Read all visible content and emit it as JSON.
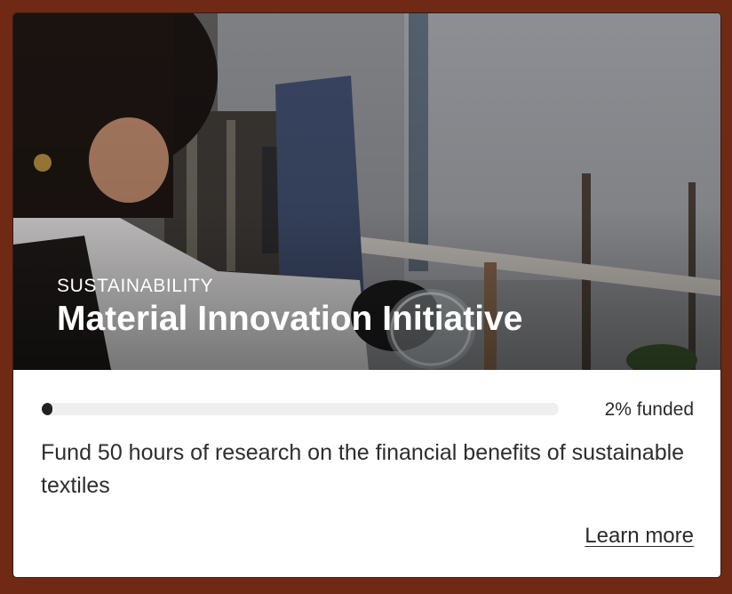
{
  "hero": {
    "category": "SUSTAINABILITY",
    "title": "Material Innovation Initiative"
  },
  "funding": {
    "percent": 2,
    "label": "2% funded"
  },
  "description": "Fund 50 hours of research on the financial benefits of sustainable textiles",
  "link": {
    "label": "Learn more"
  },
  "colors": {
    "frame": "#6f2914",
    "card": "#ffffff",
    "progress_track": "#efefef",
    "progress_fill": "#222222",
    "text": "#2d2d2d"
  }
}
